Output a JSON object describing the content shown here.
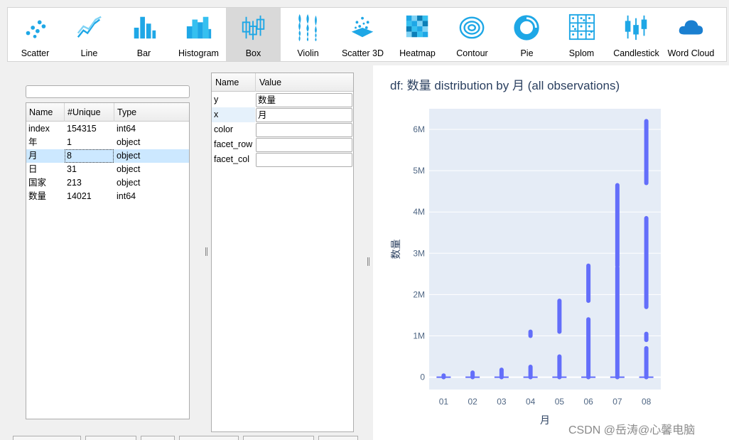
{
  "toolbar": {
    "buttons": [
      {
        "label": "Scatter",
        "icon": "scatter-icon"
      },
      {
        "label": "Line",
        "icon": "line-icon"
      },
      {
        "label": "Bar",
        "icon": "bar-icon"
      },
      {
        "label": "Histogram",
        "icon": "histogram-icon"
      },
      {
        "label": "Box",
        "icon": "box-icon",
        "active": true
      },
      {
        "label": "Violin",
        "icon": "violin-icon"
      },
      {
        "label": "Scatter 3D",
        "icon": "scatter3d-icon"
      },
      {
        "label": "Heatmap",
        "icon": "heatmap-icon"
      },
      {
        "label": "Contour",
        "icon": "contour-icon"
      },
      {
        "label": "Pie",
        "icon": "pie-icon"
      },
      {
        "label": "Splom",
        "icon": "splom-icon"
      },
      {
        "label": "Candlestick",
        "icon": "candlestick-icon"
      },
      {
        "label": "Word Cloud",
        "icon": "cloud-icon"
      }
    ],
    "icon_color": "#1ea7e6"
  },
  "columns_table": {
    "filter_value": "",
    "headers": [
      "Name",
      "#Unique",
      "Type"
    ],
    "rows": [
      {
        "name": "index",
        "unique": "154315",
        "type": "int64"
      },
      {
        "name": "年",
        "unique": "1",
        "type": "object"
      },
      {
        "name": "月",
        "unique": "8",
        "type": "object",
        "selected": true
      },
      {
        "name": "日",
        "unique": "31",
        "type": "object"
      },
      {
        "name": "国家",
        "unique": "213",
        "type": "object"
      },
      {
        "name": "数量",
        "unique": "14021",
        "type": "int64"
      }
    ]
  },
  "args_table": {
    "headers": [
      "Name",
      "Value"
    ],
    "rows": [
      {
        "name": "y",
        "value": "数量"
      },
      {
        "name": "x",
        "value": "月",
        "selected": true
      },
      {
        "name": "color",
        "value": ""
      },
      {
        "name": "facet_row",
        "value": ""
      },
      {
        "name": "facet_col",
        "value": ""
      }
    ]
  },
  "chart": {
    "title": "df: 数量 distribution by 月 (all observations)",
    "watermark": "CSDN @岳涛@心馨电脑"
  },
  "chart_data": {
    "type": "box",
    "title": "df: 数量 distribution by 月 (all observations)",
    "xlabel": "月",
    "ylabel": "数量",
    "categories": [
      "01",
      "02",
      "03",
      "04",
      "05",
      "06",
      "07",
      "08"
    ],
    "ylim": [
      -300000,
      6500000
    ],
    "yticks": [
      0,
      1000000,
      2000000,
      3000000,
      4000000,
      5000000,
      6000000
    ],
    "ytick_labels": [
      "0",
      "1M",
      "2M",
      "3M",
      "4M",
      "5M",
      "6M"
    ],
    "grid": true,
    "plot_bg": "#e5ecf6",
    "marker_color": "#636efa",
    "point_ranges": [
      [
        [
          0,
          40000
        ]
      ],
      [
        [
          0,
          110000
        ]
      ],
      [
        [
          0,
          180000
        ]
      ],
      [
        [
          0,
          250000
        ],
        [
          1000000,
          1100000
        ]
      ],
      [
        [
          0,
          500000
        ],
        [
          1100000,
          1850000
        ]
      ],
      [
        [
          0,
          1400000
        ],
        [
          1850000,
          2700000
        ]
      ],
      [
        [
          0,
          2650000
        ],
        [
          2700000,
          4650000
        ]
      ],
      [
        [
          0,
          700000
        ],
        [
          900000,
          1050000
        ],
        [
          1700000,
          3850000
        ],
        [
          4700000,
          6200000
        ]
      ]
    ]
  }
}
